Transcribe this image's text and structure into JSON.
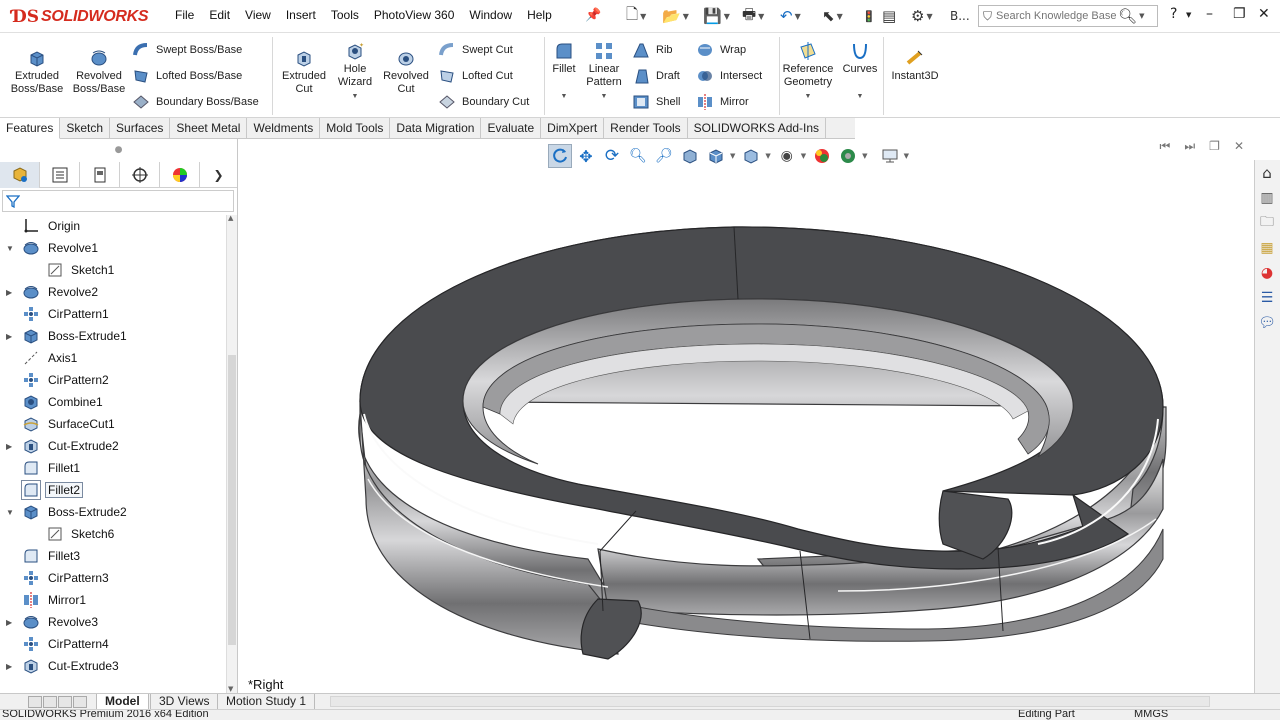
{
  "app": {
    "brand": "SOLIDWORKS",
    "menu": [
      "File",
      "Edit",
      "View",
      "Insert",
      "Tools",
      "PhotoView 360",
      "Window",
      "Help"
    ],
    "quick_access_truncated": "B...",
    "search_placeholder": "Search Knowledge Base"
  },
  "command_manager": {
    "extruded_boss": "Extruded\nBoss/Base",
    "revolved_boss": "Revolved\nBoss/Base",
    "swept_boss": "Swept Boss/Base",
    "lofted_boss": "Lofted Boss/Base",
    "boundary_boss": "Boundary Boss/Base",
    "extruded_cut": "Extruded\nCut",
    "hole_wizard": "Hole\nWizard",
    "revolved_cut": "Revolved\nCut",
    "swept_cut": "Swept Cut",
    "lofted_cut": "Lofted Cut",
    "boundary_cut": "Boundary Cut",
    "fillet": "Fillet",
    "linear_pattern": "Linear\nPattern",
    "rib": "Rib",
    "draft": "Draft",
    "shell": "Shell",
    "wrap": "Wrap",
    "intersect": "Intersect",
    "mirror": "Mirror",
    "reference_geometry": "Reference\nGeometry",
    "curves": "Curves",
    "instant3d": "Instant3D"
  },
  "tabs": [
    "Features",
    "Sketch",
    "Surfaces",
    "Sheet Metal",
    "Weldments",
    "Mold Tools",
    "Data Migration",
    "Evaluate",
    "DimXpert",
    "Render Tools",
    "SOLIDWORKS Add-Ins"
  ],
  "active_tab": "Features",
  "feature_tree": [
    {
      "label": "Origin",
      "indent": 0,
      "expand": "",
      "icon": "origin-icon"
    },
    {
      "label": "Revolve1",
      "indent": 0,
      "expand": "▼",
      "icon": "revolve-icon"
    },
    {
      "label": "Sketch1",
      "indent": 1,
      "expand": "",
      "icon": "sketch-icon"
    },
    {
      "label": "Revolve2",
      "indent": 0,
      "expand": "▶",
      "icon": "revolve-icon"
    },
    {
      "label": "CirPattern1",
      "indent": 0,
      "expand": "",
      "icon": "pattern-icon"
    },
    {
      "label": "Boss-Extrude1",
      "indent": 0,
      "expand": "▶",
      "icon": "extrude-icon"
    },
    {
      "label": "Axis1",
      "indent": 0,
      "expand": "",
      "icon": "axis-icon"
    },
    {
      "label": "CirPattern2",
      "indent": 0,
      "expand": "",
      "icon": "pattern-icon"
    },
    {
      "label": "Combine1",
      "indent": 0,
      "expand": "",
      "icon": "combine-icon"
    },
    {
      "label": "SurfaceCut1",
      "indent": 0,
      "expand": "",
      "icon": "surface-cut-icon"
    },
    {
      "label": "Cut-Extrude2",
      "indent": 0,
      "expand": "▶",
      "icon": "cut-extrude-icon"
    },
    {
      "label": "Fillet1",
      "indent": 0,
      "expand": "",
      "icon": "fillet-icon"
    },
    {
      "label": "Fillet2",
      "indent": 0,
      "expand": "",
      "icon": "fillet-icon",
      "highlight": true
    },
    {
      "label": "Boss-Extrude2",
      "indent": 0,
      "expand": "▼",
      "icon": "extrude-icon"
    },
    {
      "label": "Sketch6",
      "indent": 1,
      "expand": "",
      "icon": "sketch-icon"
    },
    {
      "label": "Fillet3",
      "indent": 0,
      "expand": "",
      "icon": "fillet-icon"
    },
    {
      "label": "CirPattern3",
      "indent": 0,
      "expand": "",
      "icon": "pattern-icon"
    },
    {
      "label": "Mirror1",
      "indent": 0,
      "expand": "",
      "icon": "mirror-icon"
    },
    {
      "label": "Revolve3",
      "indent": 0,
      "expand": "▶",
      "icon": "revolve-icon"
    },
    {
      "label": "CirPattern4",
      "indent": 0,
      "expand": "",
      "icon": "pattern-icon"
    },
    {
      "label": "Cut-Extrude3",
      "indent": 0,
      "expand": "▶",
      "icon": "cut-extrude-icon"
    }
  ],
  "viewport": {
    "view_name": "*Right"
  },
  "bottom_tabs": [
    "Model",
    "3D Views",
    "Motion Study 1"
  ],
  "active_bottom_tab": "Model",
  "status": {
    "left": "SOLIDWORKS Premium 2016 x64 Edition",
    "mode": "Editing Part",
    "units": "MMGS"
  },
  "colors": {
    "brand_red": "#d52b1e",
    "accent_blue": "#1a6fc4",
    "part_dark": "#4a4b4e"
  }
}
